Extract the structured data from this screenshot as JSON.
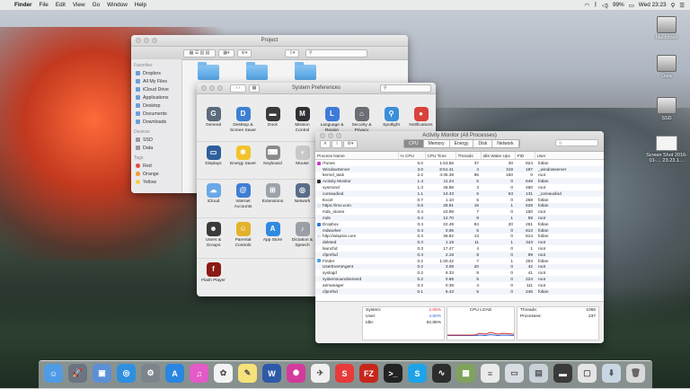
{
  "menubar": {
    "apple": "",
    "items": [
      "Finder",
      "File",
      "Edit",
      "View",
      "Go",
      "Window",
      "Help"
    ],
    "battery": "99%",
    "clock": "Wed 23:23"
  },
  "desktop": {
    "icons": [
      "Macintosh",
      "Data",
      "SSD",
      "Screen Shot 2016-01-… 23.23.1…"
    ]
  },
  "finder": {
    "title": "Project",
    "sections": {
      "favorites": "Favorites",
      "devices": "Devices",
      "tags": "Tags"
    },
    "favorites": [
      "Dropbox",
      "All My Files",
      "iCloud Drive",
      "Applications",
      "Desktop",
      "Documents",
      "Downloads"
    ],
    "devices": [
      "SSD",
      "Data"
    ],
    "tags": [
      {
        "label": "Red",
        "color": "#e84a3c"
      },
      {
        "label": "Orange",
        "color": "#f39c2a"
      },
      {
        "label": "Yellow",
        "color": "#f4d03f"
      }
    ]
  },
  "syspref": {
    "title": "System Preferences",
    "panes": [
      {
        "label": "General",
        "color": "#5b6b7c",
        "glyph": "G"
      },
      {
        "label": "Desktop & Screen Saver",
        "color": "#3e7fd2",
        "glyph": "D"
      },
      {
        "label": "Dock",
        "color": "#3a3a3a",
        "glyph": "▬"
      },
      {
        "label": "Mission Control",
        "color": "#2f2f34",
        "glyph": "M"
      },
      {
        "label": "Language & Region",
        "color": "#3d7ad8",
        "glyph": "L"
      },
      {
        "label": "Security & Privacy",
        "color": "#6b6f75",
        "glyph": "⌂"
      },
      {
        "label": "Spotlight",
        "color": "#3a8fd8",
        "glyph": "⚲"
      },
      {
        "label": "Notifications",
        "color": "#d8423a",
        "glyph": "●"
      },
      {
        "label": "Displays",
        "color": "#2e5f9c",
        "glyph": "▭"
      },
      {
        "label": "Energy Saver",
        "color": "#f2c32c",
        "glyph": "✱"
      },
      {
        "label": "Keyboard",
        "color": "#8a8a8a",
        "glyph": "⌨"
      },
      {
        "label": "Mouse",
        "color": "#c8c8c8",
        "glyph": "◖"
      },
      {
        "label": "iCloud",
        "color": "#6aa8e6",
        "glyph": "☁"
      },
      {
        "label": "Internet Accounts",
        "color": "#3f7ed6",
        "glyph": "@"
      },
      {
        "label": "Extensions",
        "color": "#9ca3ab",
        "glyph": "⊞"
      },
      {
        "label": "Network",
        "color": "#5a6e8a",
        "glyph": "◎"
      },
      {
        "label": "Users & Groups",
        "color": "#3a3a3a",
        "glyph": "☻"
      },
      {
        "label": "Parental Controls",
        "color": "#e2b22a",
        "glyph": "☺"
      },
      {
        "label": "App Store",
        "color": "#2f8ae0",
        "glyph": "A"
      },
      {
        "label": "Dictation & Speech",
        "color": "#9b9fa6",
        "glyph": "♪"
      },
      {
        "label": "Flash Player",
        "color": "#8c1a14",
        "glyph": "f"
      }
    ]
  },
  "activity": {
    "title": "Activity Monitor (All Processes)",
    "tabs": [
      "CPU",
      "Memory",
      "Energy",
      "Disk",
      "Network"
    ],
    "active_tab": "CPU",
    "columns": [
      "Process Name",
      "% CPU",
      "CPU Time",
      "Threads",
      "Idle Wake Ups",
      "PID",
      "User"
    ],
    "rows": [
      {
        "name": "iTunes",
        "icon": "#c93ac7",
        "cpu": "6.0",
        "time": "1:53.55",
        "threads": "37",
        "idle": "30",
        "pid": "824",
        "user": "fotlan"
      },
      {
        "name": "WindowServer",
        "icon": "",
        "cpu": "3.0",
        "time": "6:51.41",
        "threads": "4",
        "idle": "319",
        "pid": "187",
        "user": "_windowserver"
      },
      {
        "name": "kernel_task",
        "icon": "",
        "cpu": "2.2",
        "time": "4:35.38",
        "threads": "96",
        "idle": "150",
        "pid": "0",
        "user": "root"
      },
      {
        "name": "Activity Monitor",
        "icon": "#2b2b2b",
        "cpu": "1.4",
        "time": "11.24",
        "threads": "6",
        "idle": "0",
        "pid": "649",
        "user": "fotlan"
      },
      {
        "name": "sysmond",
        "icon": "",
        "cpu": "1.3",
        "time": "46.88",
        "threads": "3",
        "idle": "0",
        "pid": "460",
        "user": "root"
      },
      {
        "name": "coreaudiod",
        "icon": "",
        "cpu": "1.1",
        "time": "14.43",
        "threads": "6",
        "idle": "63",
        "pid": "131",
        "user": "_coreaudiod"
      },
      {
        "name": "Excel",
        "icon": "",
        "cpu": "0.7",
        "time": "1.10",
        "threads": "5",
        "idle": "0",
        "pid": "268",
        "user": "fotlan"
      },
      {
        "name": "https://imo.com",
        "icon": "#dfe8f2",
        "cpu": "0.6",
        "time": "28.91",
        "threads": "15",
        "idle": "1",
        "pid": "528",
        "user": "fotlan"
      },
      {
        "name": "mds_stores",
        "icon": "",
        "cpu": "0.4",
        "time": "22.98",
        "threads": "7",
        "idle": "0",
        "pid": "150",
        "user": "root"
      },
      {
        "name": "mds",
        "icon": "",
        "cpu": "0.4",
        "time": "12.70",
        "threads": "8",
        "idle": "1",
        "pid": "58",
        "user": "root"
      },
      {
        "name": "Dropbox",
        "icon": "#2a7ad8",
        "cpu": "0.4",
        "time": "22.49",
        "threads": "84",
        "idle": "20",
        "pid": "261",
        "user": "fotlan"
      },
      {
        "name": "mdworker",
        "icon": "",
        "cpu": "0.4",
        "time": "0.05",
        "threads": "6",
        "idle": "0",
        "pid": "813",
        "user": "fotlan"
      },
      {
        "name": "http://wispsin.com",
        "icon": "#dfe8f2",
        "cpu": "0.4",
        "time": "36.92",
        "threads": "13",
        "idle": "0",
        "pid": "814",
        "user": "fotlan"
      },
      {
        "name": "deleted",
        "icon": "",
        "cpu": "0.3",
        "time": "1.18",
        "threads": "11",
        "idle": "1",
        "pid": "343",
        "user": "root"
      },
      {
        "name": "launchd",
        "icon": "",
        "cpu": "0.3",
        "time": "17.47",
        "threads": "4",
        "idle": "0",
        "pid": "1",
        "user": "root"
      },
      {
        "name": "cfprefsd",
        "icon": "",
        "cpu": "0.3",
        "time": "2.19",
        "threads": "8",
        "idle": "0",
        "pid": "99",
        "user": "root"
      },
      {
        "name": "Finder",
        "icon": "#4aa0e8",
        "cpu": "0.2",
        "time": "1:20.42",
        "threads": "7",
        "idle": "1",
        "pid": "253",
        "user": "fotlan"
      },
      {
        "name": "UserEventAgent",
        "icon": "",
        "cpu": "0.2",
        "time": "3.08",
        "threads": "20",
        "idle": "0",
        "pid": "42",
        "user": "root"
      },
      {
        "name": "syslogd",
        "icon": "",
        "cpu": "0.2",
        "time": "9.33",
        "threads": "8",
        "idle": "0",
        "pid": "41",
        "user": "root"
      },
      {
        "name": "systemsoundserverd",
        "icon": "",
        "cpu": "0.2",
        "time": "0.68",
        "threads": "5",
        "idle": "0",
        "pid": "224",
        "user": "root"
      },
      {
        "name": "airmanager",
        "icon": "",
        "cpu": "0.2",
        "time": "0.38",
        "threads": "4",
        "idle": "0",
        "pid": "111",
        "user": "root"
      },
      {
        "name": "cfprefsd",
        "icon": "",
        "cpu": "0.1",
        "time": "5.43",
        "threads": "5",
        "idle": "0",
        "pid": "246",
        "user": "fotlan"
      }
    ],
    "footer": {
      "system_label": "System:",
      "system_value": "2.05%",
      "user_label": "User:",
      "user_value": "4.60%",
      "idle_label": "Idle:",
      "idle_value": "92.85%",
      "load_label": "CPU LOAD",
      "threads_label": "Threads:",
      "threads_value": "1065",
      "processes_label": "Processes:",
      "processes_value": "237"
    }
  },
  "dock": {
    "apps": [
      {
        "name": "Finder",
        "color": "#4f9be6",
        "glyph": "☺"
      },
      {
        "name": "Launchpad",
        "color": "#6b7480",
        "glyph": "🚀"
      },
      {
        "name": "Preview",
        "color": "#5c8fd6",
        "glyph": "▣"
      },
      {
        "name": "Safari",
        "color": "#2f8fe0",
        "glyph": "◎"
      },
      {
        "name": "System Preferences",
        "color": "#7d848c",
        "glyph": "⚙"
      },
      {
        "name": "App Store",
        "color": "#2a86e0",
        "glyph": "A"
      },
      {
        "name": "iTunes",
        "color": "#e35ac8",
        "glyph": "♫"
      },
      {
        "name": "Photos",
        "color": "#f3f3f3",
        "glyph": "✿"
      },
      {
        "name": "Notes",
        "color": "#f6e27a",
        "glyph": "✎"
      },
      {
        "name": "Word",
        "color": "#2c5aa8",
        "glyph": "W"
      },
      {
        "name": "Flower",
        "color": "#d43a9c",
        "glyph": "✺"
      },
      {
        "name": "Send",
        "color": "#f0f0f0",
        "glyph": "✈"
      },
      {
        "name": "Sketch",
        "color": "#e83a3a",
        "glyph": "S"
      },
      {
        "name": "FileZilla",
        "color": "#c8261b",
        "glyph": "FZ"
      },
      {
        "name": "Terminal",
        "color": "#222222",
        "glyph": ">_"
      },
      {
        "name": "Skype",
        "color": "#1fa3e8",
        "glyph": "S"
      },
      {
        "name": "Activity Monitor",
        "color": "#2d2d2d",
        "glyph": "∿"
      },
      {
        "name": "Image",
        "color": "#7fa35a",
        "glyph": "▦"
      },
      {
        "name": "Document",
        "color": "#eaeaea",
        "glyph": "≡"
      },
      {
        "name": "Screen Shot",
        "color": "#d9dde3",
        "glyph": "▭"
      },
      {
        "name": "Folder",
        "color": "#c9d1d9",
        "glyph": "▤"
      },
      {
        "name": "Activity",
        "color": "#3a3a3a",
        "glyph": "▬"
      },
      {
        "name": "Item",
        "color": "#e5e5e5",
        "glyph": "▢"
      },
      {
        "name": "Downloads",
        "color": "#c9d6e3",
        "glyph": "⬇"
      },
      {
        "name": "Trash",
        "color": "#d9d9d9",
        "glyph": "🗑"
      }
    ]
  }
}
